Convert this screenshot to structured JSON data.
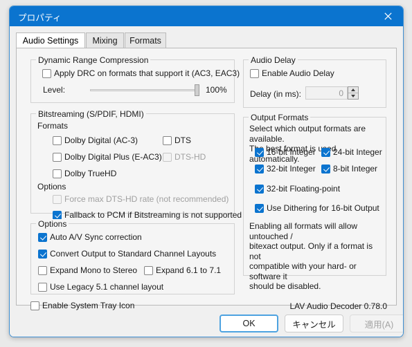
{
  "window": {
    "title": "プロパティ",
    "close_icon": "close-icon"
  },
  "tabs": [
    {
      "label": "Audio Settings",
      "selected": true
    },
    {
      "label": "Mixing",
      "selected": false
    },
    {
      "label": "Formats",
      "selected": false
    }
  ],
  "drc": {
    "legend": "Dynamic Range Compression",
    "apply_label": "Apply DRC on formats that support it (AC3, EAC3)",
    "level_label": "Level:",
    "level_value": "100%"
  },
  "bitstreaming": {
    "legend": "Bitstreaming (S/PDIF, HDMI)",
    "formats_label": "Formats",
    "formats": [
      {
        "label": "Dolby Digital (AC-3)"
      },
      {
        "label": "DTS"
      },
      {
        "label": "Dolby Digital Plus (E-AC3)"
      },
      {
        "label": "DTS-HD"
      },
      {
        "label": "Dolby TrueHD"
      }
    ],
    "options_label": "Options",
    "options": [
      {
        "label": "Force max DTS-HD rate (not recommended)"
      },
      {
        "label": "Fallback to PCM if Bitstreaming is not supported"
      }
    ]
  },
  "options": {
    "legend": "Options",
    "items": [
      {
        "label": "Auto A/V Sync correction"
      },
      {
        "label": "Convert Output to Standard Channel Layouts"
      },
      {
        "label": "Expand Mono to Stereo"
      },
      {
        "label": "Expand 6.1 to 7.1"
      },
      {
        "label": "Use Legacy 5.1 channel layout"
      }
    ]
  },
  "audio_delay": {
    "legend": "Audio Delay",
    "enable_label": "Enable Audio Delay",
    "delay_label": "Delay (in ms):",
    "delay_value": "0"
  },
  "output_formats": {
    "legend": "Output Formats",
    "description": "Select which output formats are available.\nThe best format is used automatically.",
    "items": [
      {
        "label": "16-bit Integer"
      },
      {
        "label": "24-bit Integer"
      },
      {
        "label": "32-bit Integer"
      },
      {
        "label": "8-bit Integer"
      },
      {
        "label": "32-bit Floating-point"
      },
      {
        "label": "Use Dithering for 16-bit Output"
      }
    ],
    "note": "Enabling all formats will allow untouched /\nbitexact output. Only if a format is not\ncompatible with your hard- or software it\nshould be disabled."
  },
  "footer": {
    "tray_label": "Enable System Tray Icon",
    "version": "LAV Audio Decoder 0.78.0"
  },
  "buttons": {
    "ok": "OK",
    "cancel": "キャンセル",
    "apply": "適用(A)"
  },
  "colors": {
    "accent": "#0b74cf",
    "focus_border": "#4da2e0",
    "panel": "#f5f5f5"
  }
}
